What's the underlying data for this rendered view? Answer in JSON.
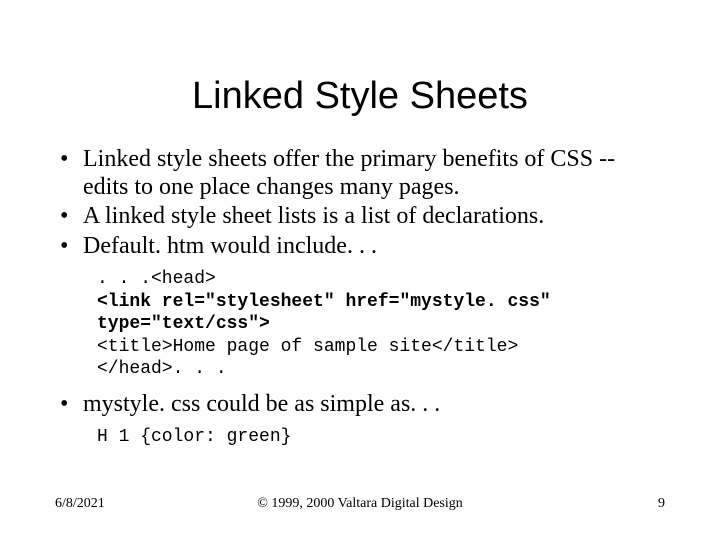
{
  "title": "Linked Style Sheets",
  "bullets": {
    "b1": "Linked style sheets offer the primary benefits of CSS -- edits to one place changes many pages.",
    "b2": "A linked style sheet lists is a list of declarations.",
    "b3": "Default. htm would include. . .",
    "b4": "mystyle. css could be as simple as. . ."
  },
  "code1": {
    "l1": ". . .<head>",
    "l2": "<link rel=\"stylesheet\" href=\"mystyle. css\" type=\"text/css\">",
    "l3": "<title>Home page of sample site</title>",
    "l4": "</head>. . ."
  },
  "code2": {
    "l1": "H 1 {color: green}"
  },
  "footer": {
    "date": "6/8/2021",
    "copyright": "© 1999, 2000 Valtara Digital Design",
    "page": "9"
  }
}
